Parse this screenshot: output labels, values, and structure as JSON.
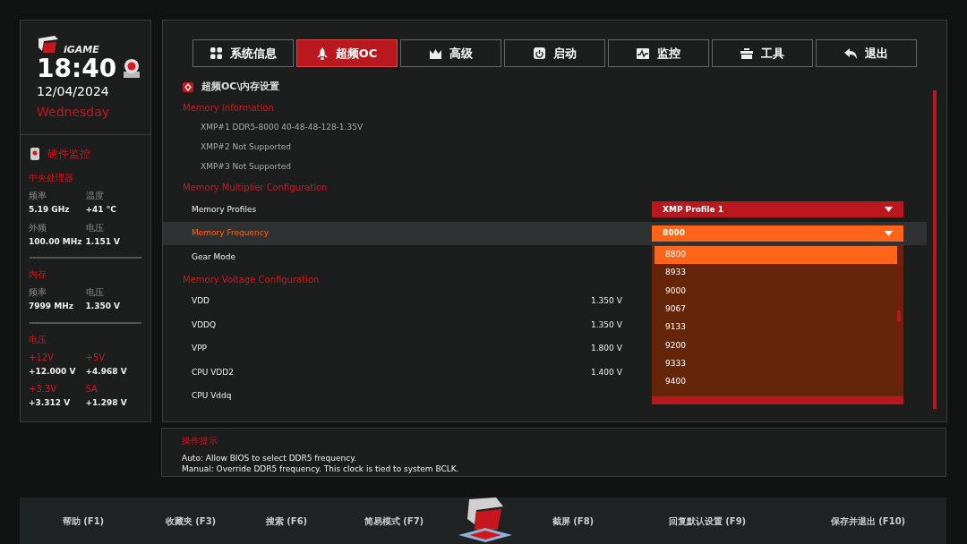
{
  "clock": {
    "brand": "iGAME",
    "time": "18:40",
    "date": "12/04/2024",
    "weekday": "Wednesday"
  },
  "monitor": {
    "title": "硬件监控",
    "sections": [
      {
        "title": "中央处理器",
        "highlight_labels": false,
        "items": [
          {
            "label": "频率",
            "value": "5.19 GHz"
          },
          {
            "label": "温度",
            "value": "+41 °C"
          },
          {
            "label": "外频",
            "value": "100.00 MHz"
          },
          {
            "label": "电压",
            "value": "1.151 V"
          }
        ]
      },
      {
        "title": "内存",
        "highlight_labels": false,
        "items": [
          {
            "label": "频率",
            "value": "7999 MHz"
          },
          {
            "label": "电压",
            "value": "1.350 V"
          }
        ]
      },
      {
        "title": "电压",
        "highlight_labels": true,
        "items": [
          {
            "label": "+12V",
            "value": "+12.000 V"
          },
          {
            "label": "+5V",
            "value": "+4.968 V"
          },
          {
            "label": "+3.3V",
            "value": "+3.312 V"
          },
          {
            "label": "SA",
            "value": "+1.298 V"
          }
        ]
      }
    ]
  },
  "tabs": [
    {
      "label": "系统信息",
      "selected": false
    },
    {
      "label": "超频OC",
      "selected": true
    },
    {
      "label": "高级",
      "selected": false
    },
    {
      "label": "启动",
      "selected": false
    },
    {
      "label": "监控",
      "selected": false
    },
    {
      "label": "工具",
      "selected": false
    },
    {
      "label": "退出",
      "selected": false
    }
  ],
  "breadcrumb": "超频OC\\内存设置",
  "rows": [
    {
      "kind": "header",
      "label": "Memory Information"
    },
    {
      "kind": "info",
      "label": "XMP#1 DDR5-8000 40-48-48-128-1.35V"
    },
    {
      "kind": "info",
      "label": "XMP#2 Not Supported"
    },
    {
      "kind": "info",
      "label": "XMP#3 Not Supported"
    },
    {
      "kind": "header",
      "label": "Memory Multiplier Configuration"
    },
    {
      "kind": "setting",
      "label": "Memory Profiles",
      "selected": false,
      "value": "XMP Profile 1"
    },
    {
      "kind": "setting",
      "label": "Memory Frequency",
      "selected": true,
      "value": "8000",
      "expanded": true,
      "options": [
        {
          "label": "8800",
          "selected": true
        },
        {
          "label": "8933",
          "selected": false
        },
        {
          "label": "9000",
          "selected": false
        },
        {
          "label": "9067",
          "selected": false
        },
        {
          "label": "9133",
          "selected": false
        },
        {
          "label": "9200",
          "selected": false
        },
        {
          "label": "9333",
          "selected": false
        },
        {
          "label": "9400",
          "selected": false
        }
      ]
    },
    {
      "kind": "setting",
      "label": "Gear Mode",
      "selected": false
    },
    {
      "kind": "header",
      "label": "Memory Voltage Configuration"
    },
    {
      "kind": "setting",
      "label": "VDD",
      "selected": false,
      "reading": "1.350 V"
    },
    {
      "kind": "setting",
      "label": "VDDQ",
      "selected": false,
      "reading": "1.350 V"
    },
    {
      "kind": "setting",
      "label": "VPP",
      "selected": false,
      "reading": "1.800 V"
    },
    {
      "kind": "setting",
      "label": "CPU VDD2",
      "selected": false,
      "reading": "1.400 V"
    },
    {
      "kind": "setting",
      "label": "CPU Vddq",
      "selected": false,
      "has_dropdown": true
    }
  ],
  "help": {
    "title": "操作提示",
    "lines": [
      "Auto: Allow BIOS to select DDR5 frequency.",
      "Manual: Override DDR5 frequency. This clock is tied to system BCLK."
    ]
  },
  "footer": [
    "帮助 (F1)",
    "收藏夹 (F3)",
    "搜索 (F6)",
    "简易模式 (F7)",
    "截屏 (F8)",
    "回复默认设置 (F9)",
    "保存并退出 (F10)"
  ]
}
